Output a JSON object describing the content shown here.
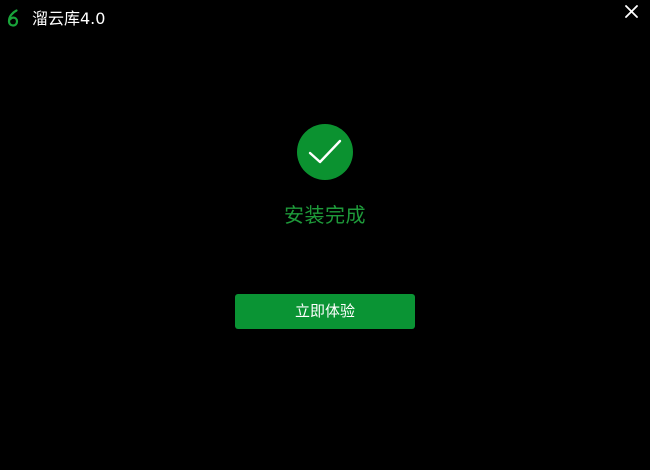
{
  "window": {
    "title": "溜云库4.0",
    "logo_icon": "liuyunku-logo-icon",
    "close_icon": "close-icon"
  },
  "main": {
    "status_icon": "checkmark-circle-icon",
    "status_text": "安装完成",
    "cta_label": "立即体验"
  },
  "colors": {
    "background": "#000000",
    "accent_green": "#0a9434",
    "status_text_green": "#1e9a3a",
    "icon_circle_green": "#0b9230",
    "title_text": "#ffffff"
  }
}
